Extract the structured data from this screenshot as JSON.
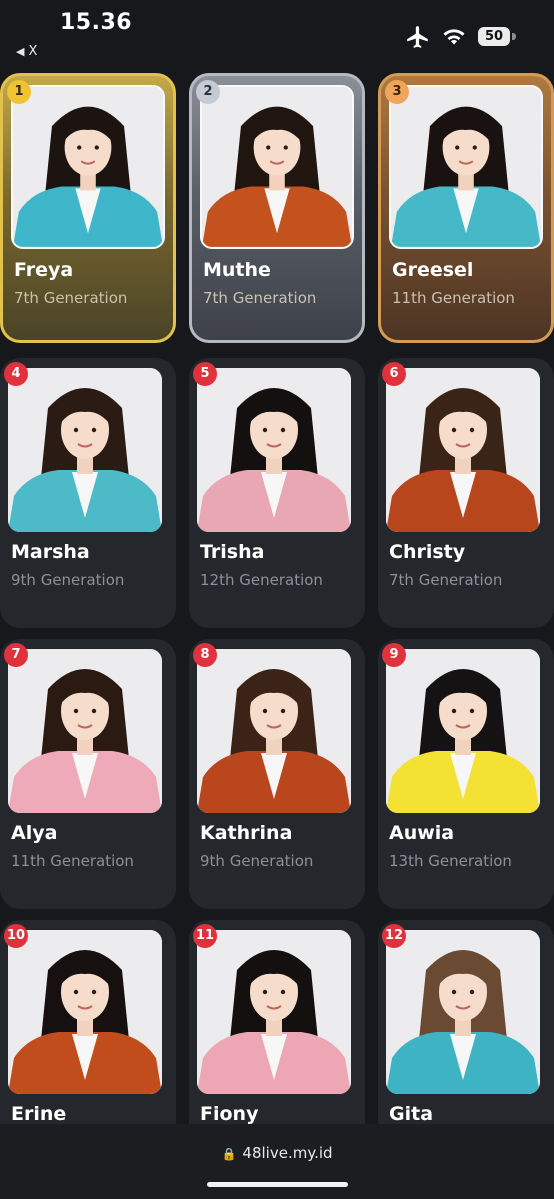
{
  "status_bar": {
    "time": "15.36",
    "back_label": "X",
    "battery": "50"
  },
  "members": [
    {
      "rank": "1",
      "name": "Freya",
      "generation": "7th Generation",
      "outfit": "#3fb6c9",
      "hair": "#1c1411"
    },
    {
      "rank": "2",
      "name": "Muthe",
      "generation": "7th Generation",
      "outfit": "#c4521e",
      "hair": "#21160f"
    },
    {
      "rank": "3",
      "name": "Greesel",
      "generation": "11th Generation",
      "outfit": "#45b9c8",
      "hair": "#1a1210"
    },
    {
      "rank": "4",
      "name": "Marsha",
      "generation": "9th Generation",
      "outfit": "#4cbac7",
      "hair": "#2a1b15"
    },
    {
      "rank": "5",
      "name": "Trisha",
      "generation": "12th Generation",
      "outfit": "#e9a7b4",
      "hair": "#141010"
    },
    {
      "rank": "6",
      "name": "Christy",
      "generation": "7th Generation",
      "outfit": "#b8461c",
      "hair": "#3a2418"
    },
    {
      "rank": "7",
      "name": "Alya",
      "generation": "11th Generation",
      "outfit": "#eeaab8",
      "hair": "#2a1a12"
    },
    {
      "rank": "8",
      "name": "Kathrina",
      "generation": "9th Generation",
      "outfit": "#b9461d",
      "hair": "#3b2417"
    },
    {
      "rank": "9",
      "name": "Auwia",
      "generation": "13th Generation",
      "outfit": "#f3e234",
      "hair": "#141212"
    },
    {
      "rank": "10",
      "name": "Erine",
      "generation": "",
      "outfit": "#c14d1d",
      "hair": "#161010"
    },
    {
      "rank": "11",
      "name": "Fiony",
      "generation": "",
      "outfit": "#eda6b3",
      "hair": "#141010"
    },
    {
      "rank": "12",
      "name": "Gita",
      "generation": "",
      "outfit": "#3eb3c3",
      "hair": "#6a4a32"
    }
  ],
  "url_bar": {
    "url": "48live.my.id"
  },
  "colors": {
    "background": "#16181b",
    "card": "#24272c",
    "rank_badge": "#e0323c",
    "gold": "#f1c232",
    "silver": "#c5cbd5",
    "bronze": "#f0a55c"
  }
}
